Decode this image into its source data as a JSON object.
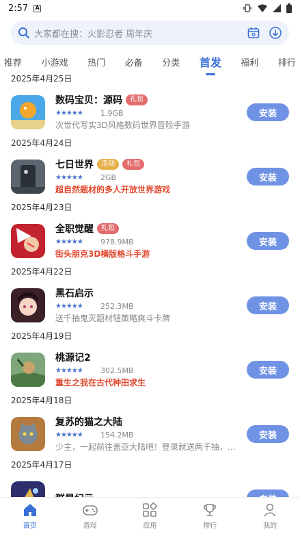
{
  "status": {
    "time": "2:57"
  },
  "search": {
    "placeholder": "大家都在搜：火影忍者 周年庆"
  },
  "tabs": [
    "推荐",
    "小游戏",
    "热门",
    "必备",
    "分类",
    "首发",
    "福利",
    "排行"
  ],
  "active_tab": "首发",
  "colors": {
    "accent": "#3a6fd8",
    "button": "#6f92e4",
    "gift_tag": "#e36c6c",
    "event_tag": "#e8b04a",
    "highlight_desc": "#e0492e"
  },
  "list": {
    "dates": [
      "2025年4月25日",
      "2025年4月24日",
      "2025年4月23日",
      "2025年4月22日",
      "2025年4月19日",
      "2025年4月18日",
      "2025年4月17日"
    ],
    "apps": [
      {
        "name": "数码宝贝：源码",
        "tags": [
          "礼包"
        ],
        "rating": "★★★★★",
        "size": "1.9GB",
        "desc": "次世代写实3D风格数码世界冒险手游",
        "install": "安装"
      },
      {
        "name": "七日世界",
        "tags": [
          "活动",
          "礼包"
        ],
        "rating": "★★★★★",
        "size": "2GB",
        "desc": "超自然题材的多人开放世界游戏",
        "install": "安装"
      },
      {
        "name": "全职觉醒",
        "tags": [
          "礼包"
        ],
        "rating": "★★★★★",
        "size": "978.9MB",
        "desc": "街头朋克3D横版格斗手游",
        "install": "安装"
      },
      {
        "name": "黑石启示",
        "tags": [],
        "rating": "★★★★★",
        "size": "252.3MB",
        "desc": "送千抽鬼灭题材轻策略爽斗卡牌",
        "install": "安装"
      },
      {
        "name": "桃源记2",
        "tags": [],
        "rating": "★★★★★",
        "size": "302.5MB",
        "desc": "重生之我在古代种田求生",
        "install": "安装"
      },
      {
        "name": "复苏的猫之大陆",
        "tags": [],
        "rating": "★★★★★",
        "size": "154.2MB",
        "desc": "少主，一起前往盖亚大陆吧！登录就送两千抽，每日...",
        "install": "安装"
      },
      {
        "name": "群星纪元",
        "tags": [],
        "rating": "",
        "size": "",
        "desc": "",
        "install": "安装"
      }
    ]
  },
  "bottom_nav": [
    "首页",
    "游戏",
    "应用",
    "排行",
    "我的"
  ]
}
